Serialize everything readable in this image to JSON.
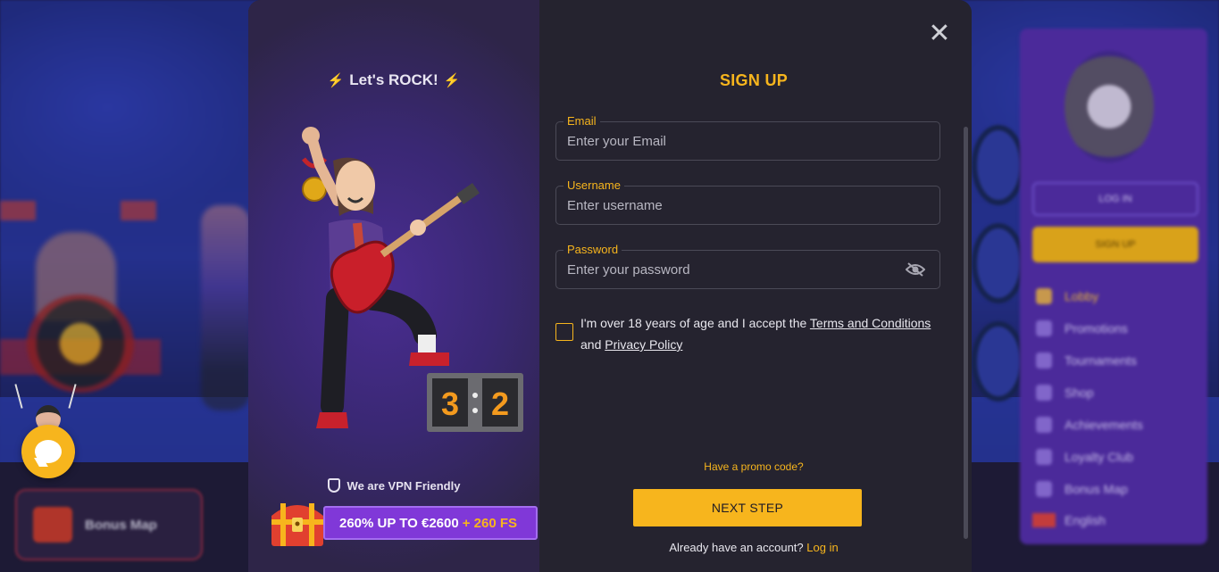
{
  "background": {
    "bonus_map_label": "Bonus Map",
    "sidebar": {
      "login_label": "LOG IN",
      "signup_label": "SIGN UP",
      "items": [
        "Lobby",
        "Promotions",
        "Tournaments",
        "Shop",
        "Achievements",
        "Loyalty Club",
        "Bonus Map"
      ],
      "language": "English"
    }
  },
  "promo": {
    "title": "Let's ROCK!",
    "score_left": "3",
    "score_right": "2",
    "vpn_text": "We are VPN Friendly",
    "bonus_main": "260% UP TO €2600",
    "bonus_fs": "+ 260 FS"
  },
  "form": {
    "title": "SIGN UP",
    "email": {
      "label": "Email",
      "placeholder": "Enter your Email",
      "value": ""
    },
    "username": {
      "label": "Username",
      "placeholder": "Enter username",
      "value": ""
    },
    "password": {
      "label": "Password",
      "placeholder": "Enter your password",
      "value": ""
    },
    "terms_prefix": "I'm over 18 years of age and I accept the",
    "terms_link": "Terms and Conditions",
    "terms_and": "and",
    "privacy_link": "Privacy Policy",
    "promo_code_link": "Have a promo code?",
    "next_button": "NEXT STEP",
    "have_account_text": "Already have an account?",
    "login_link": "Log in",
    "close_symbol": "✕"
  },
  "colors": {
    "accent": "#f7b51d",
    "modal_bg": "#25232f",
    "bonus_purple": "#8038d8"
  },
  "icons": [
    "close-icon",
    "eye-off-icon",
    "lightning-icon",
    "vpn-shield-icon",
    "chat-icon",
    "treasure-chest-icon"
  ]
}
